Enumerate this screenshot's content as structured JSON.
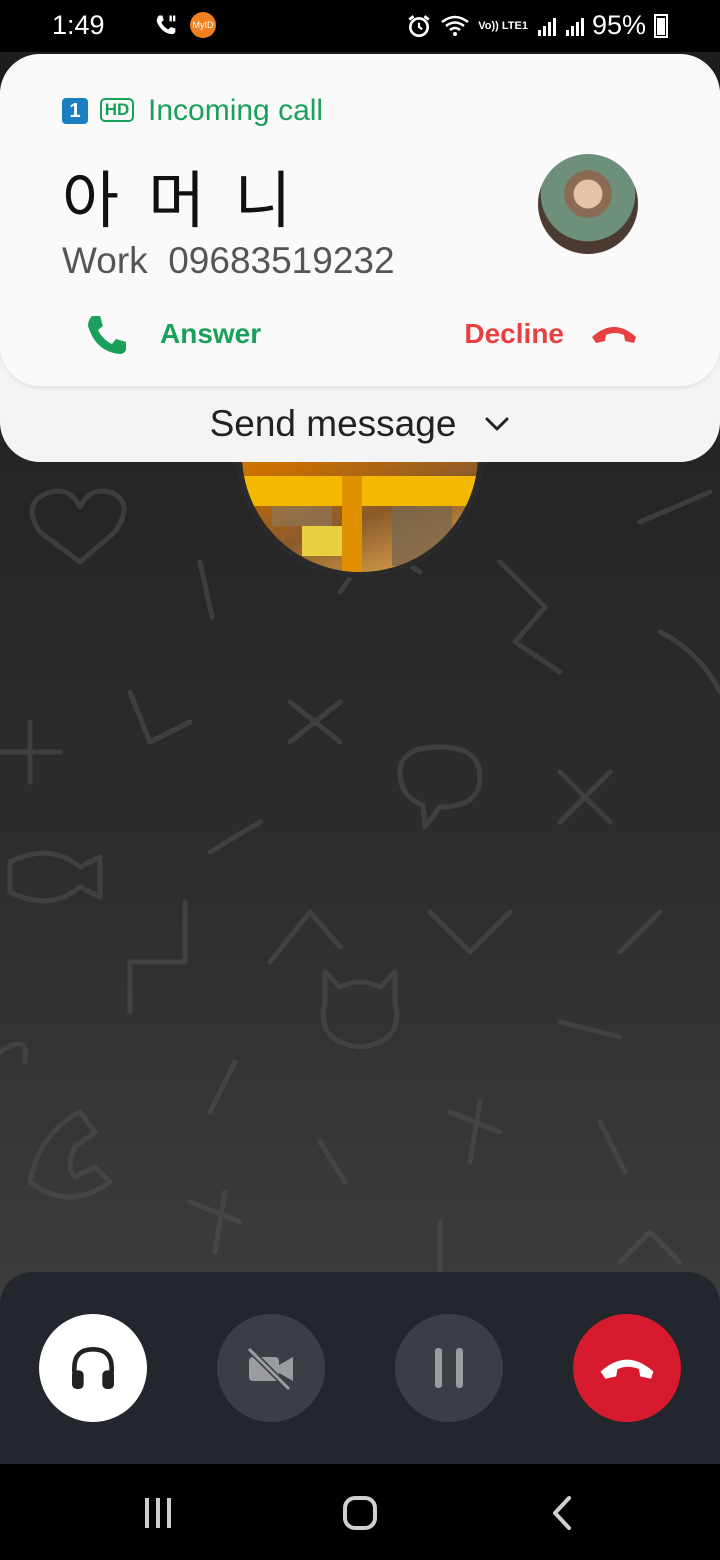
{
  "status_bar": {
    "time": "1:49",
    "app_badge": "MyID",
    "battery": "95%",
    "volte": "Vo)) LTE1"
  },
  "incoming_call": {
    "sim_slot": "1",
    "hd_label": "HD",
    "title": "Incoming call",
    "caller_name": "아 머 니",
    "number_type": "Work",
    "number": "09683519232",
    "answer_label": "Answer",
    "decline_label": "Decline",
    "send_message_label": "Send message",
    "colors": {
      "accent_green": "#19a05a",
      "decline_red": "#e84040"
    }
  },
  "controls": {
    "headset_icon": "headset-icon",
    "video_icon": "video-off-icon",
    "hold_icon": "pause-icon",
    "end_icon": "end-call-icon",
    "end_color": "#d81a2e"
  },
  "navigation": {
    "recents_icon": "recents-icon",
    "home_icon": "home-icon",
    "back_icon": "back-icon"
  }
}
